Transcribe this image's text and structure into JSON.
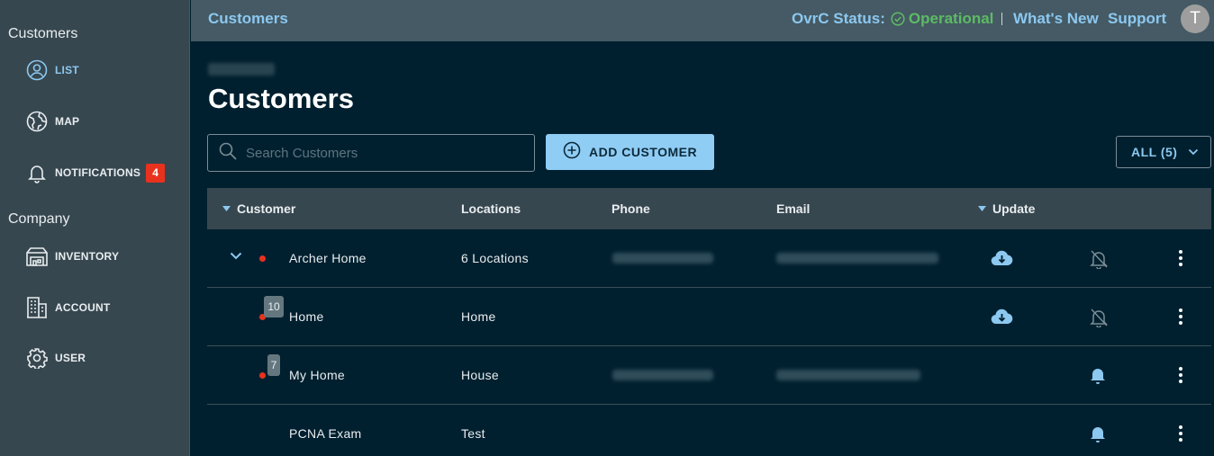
{
  "sidebar": {
    "section_customers": "Customers",
    "section_company": "Company",
    "items": [
      {
        "label": "LIST"
      },
      {
        "label": "MAP"
      },
      {
        "label": "NOTIFICATIONS",
        "badge": "4"
      },
      {
        "label": "INVENTORY"
      },
      {
        "label": "ACCOUNT"
      },
      {
        "label": "USER"
      }
    ]
  },
  "topbar": {
    "crumb": "Customers",
    "status_label": "OvrC Status:",
    "status_value": "Operational",
    "whats_new": "What's New",
    "support": "Support",
    "avatar_initial": "T"
  },
  "main": {
    "title": "Customers",
    "search_placeholder": "Search Customers",
    "add_button": "ADD CUSTOMER",
    "filter": "ALL (5)"
  },
  "table": {
    "headers": [
      "Customer",
      "Locations",
      "Phone",
      "Email",
      "Update"
    ],
    "rows": [
      {
        "name": "Archer Home",
        "location": "6 Locations",
        "badge": "",
        "update_icon": "cloud-download-icon",
        "notify_icon": "bell-off-icon"
      },
      {
        "name": "Home",
        "location": "Home",
        "badge": "10",
        "update_icon": "cloud-download-icon",
        "notify_icon": "bell-off-icon"
      },
      {
        "name": "My Home",
        "location": "House",
        "badge": "7",
        "update_icon": "",
        "notify_icon": "bell-icon"
      },
      {
        "name": "PCNA Exam",
        "location": "Test",
        "badge": "",
        "update_icon": "",
        "notify_icon": "bell-icon"
      }
    ]
  },
  "colors": {
    "accent": "#8cc8f0",
    "status_ok": "#5dbb63",
    "alert_red": "#e8321e",
    "background": "#00202f",
    "sidebar": "#37474f"
  }
}
